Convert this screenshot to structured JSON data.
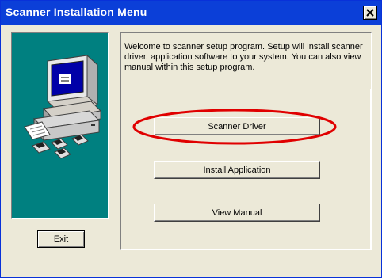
{
  "window": {
    "title": "Scanner Installation Menu"
  },
  "icons": {
    "close": "close-icon",
    "illustration": "computer-scanner-illustration"
  },
  "welcome_text": "Welcome to scanner setup program. Setup will install scanner driver, application software to your system. You can also view manual  within this setup program.",
  "buttons": {
    "scanner_driver": "Scanner Driver",
    "install_application": "Install Application",
    "view_manual": "View Manual",
    "exit": "Exit"
  },
  "colors": {
    "titlebar": "#0b3fd8",
    "side_panel": "#008080",
    "highlight": "#e00000",
    "dialog_bg": "#ece9d8"
  }
}
